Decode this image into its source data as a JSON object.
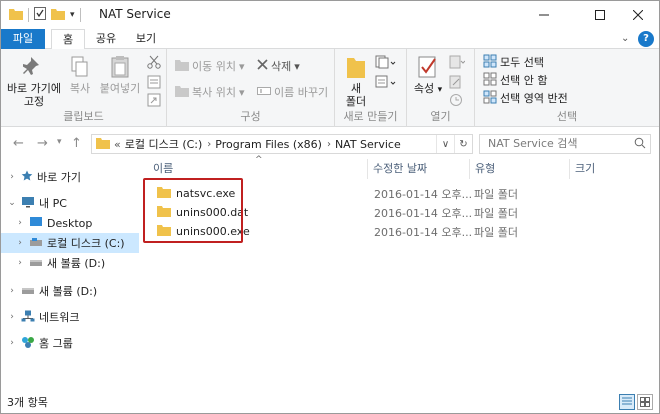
{
  "window": {
    "title": "NAT Service"
  },
  "ribbon_tabs": {
    "file": "파일",
    "home": "홈",
    "share": "공유",
    "view": "보기"
  },
  "help_label": "?",
  "clipboard": {
    "pin_label_1": "바로 가기에",
    "pin_label_2": "고정",
    "copy_label": "복사",
    "paste_label": "붙여넣기",
    "group_label": "클립보드"
  },
  "organize": {
    "move_label": "이동 위치",
    "copy_to_label": "복사 위치",
    "delete_label": "삭제",
    "rename_label": "이름 바꾸기",
    "group_label": "구성"
  },
  "new": {
    "folder_label_1": "새",
    "folder_label_2": "폴더",
    "group_label": "새로 만들기"
  },
  "open": {
    "properties_label": "속성",
    "group_label": "열기"
  },
  "select": {
    "select_all": "모두 선택",
    "select_none": "선택 안 함",
    "invert": "선택 영역 반전",
    "group_label": "선택"
  },
  "address": {
    "prefix": "«",
    "crumbs": [
      "로컬 디스크 (C:)",
      "Program Files (x86)",
      "NAT Service"
    ]
  },
  "search": {
    "placeholder": "NAT Service 검색"
  },
  "nav": {
    "quick_access": "바로 가기",
    "this_pc": "내 PC",
    "desktop": "Desktop",
    "local_disk": "로컬 디스크 (C:)",
    "new_volume_d_child": "새 볼륨 (D:)",
    "new_volume_d": "새 볼륨 (D:)",
    "network": "네트워크",
    "homegroup": "홈 그룹"
  },
  "columns": {
    "name": "이름",
    "date": "수정한 날짜",
    "type": "유형",
    "size": "크기"
  },
  "files": [
    {
      "name": "natsvc.exe",
      "date": "2016-01-14 오후...",
      "type": "파일 폴더"
    },
    {
      "name": "unins000.dat",
      "date": "2016-01-14 오후...",
      "type": "파일 폴더"
    },
    {
      "name": "unins000.exe",
      "date": "2016-01-14 오후...",
      "type": "파일 폴더"
    }
  ],
  "status": {
    "count": "3개 항목"
  },
  "colors": {
    "accent": "#1979ca",
    "selection": "#cce8ff",
    "folder": "#f0c24b",
    "highlight_box": "#c02020"
  }
}
